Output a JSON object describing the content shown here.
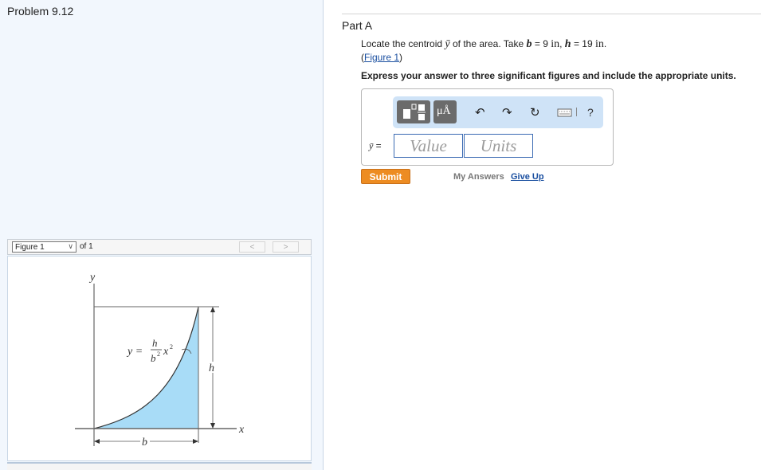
{
  "problem": {
    "title": "Problem 9.12"
  },
  "figure_nav": {
    "selected": "Figure 1",
    "of_label": "of 1",
    "prev_glyph": "<",
    "next_glyph": ">"
  },
  "figure": {
    "axis_y": "y",
    "axis_x": "x",
    "eq_lhs": "y =",
    "eq_num": "h",
    "eq_den": "b",
    "eq_den_exp": "2",
    "eq_var": "x",
    "eq_var_exp": "2",
    "dim_h": "h",
    "dim_b": "b",
    "fill_color": "#a8dcf7"
  },
  "part": {
    "title": "Part A",
    "question_prefix": "Locate the centroid",
    "question_symbol": "ȳ",
    "question_mid": "of the area. Take",
    "var_b": "b",
    "val_b": "= 9",
    "unit_b": "in",
    "var_h": "h",
    "val_h": "= 19",
    "unit_h": "in",
    "link_open": "(",
    "link_text": "Figure 1",
    "link_close": ")",
    "instruction": "Express your answer to three significant figures and include the appropriate units."
  },
  "answer": {
    "label": "ȳ",
    "eq": "=",
    "value_placeholder": "Value",
    "units_placeholder": "Units",
    "toolbar": {
      "units_button_label": "μÅ",
      "help_label": "?",
      "icons": [
        "templates-icon",
        "units-icon",
        "undo-icon",
        "redo-icon",
        "reset-icon",
        "keyboard-icon",
        "help-icon"
      ]
    }
  },
  "actions": {
    "submit": "Submit",
    "my_answers": "My Answers",
    "give_up": "Give Up"
  },
  "colors": {
    "submit_bg": "#ed8c22",
    "link": "#1a4fa0",
    "toolbar_bg": "#cfe3f7",
    "input_border": "#3b6bb3"
  }
}
